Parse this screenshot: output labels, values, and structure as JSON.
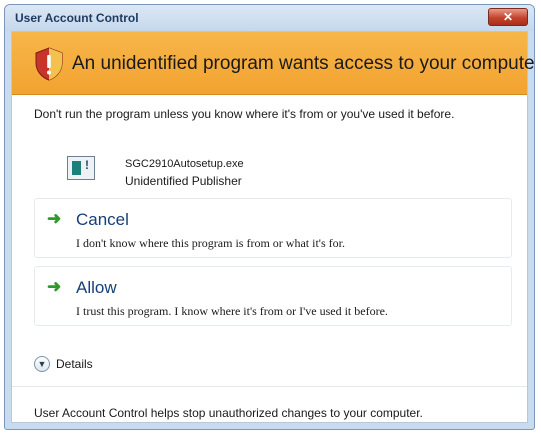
{
  "window": {
    "title": "User Account Control",
    "close_label": "✕"
  },
  "banner": {
    "icon": "uac-shield-warning-icon",
    "text": "An unidentified program wants access to your computer",
    "color": "#f4ac3c"
  },
  "warning": {
    "text": "Don't run the program unless you know where it's from or you've used it before."
  },
  "program": {
    "icon": "program-icon",
    "name": "SGC2910Autosetup.exe",
    "publisher": "Unidentified Publisher"
  },
  "options": [
    {
      "icon": "green-arrow-icon",
      "title": "Cancel",
      "description": "I don't know where this program is from or what it's for."
    },
    {
      "icon": "green-arrow-icon",
      "title": "Allow",
      "description": "I trust this program. I know where it's from or I've used it before."
    }
  ],
  "details": {
    "icon": "chevron-down-icon",
    "label": "Details"
  },
  "footer": {
    "text": "User Account Control helps stop unauthorized changes to your computer."
  }
}
